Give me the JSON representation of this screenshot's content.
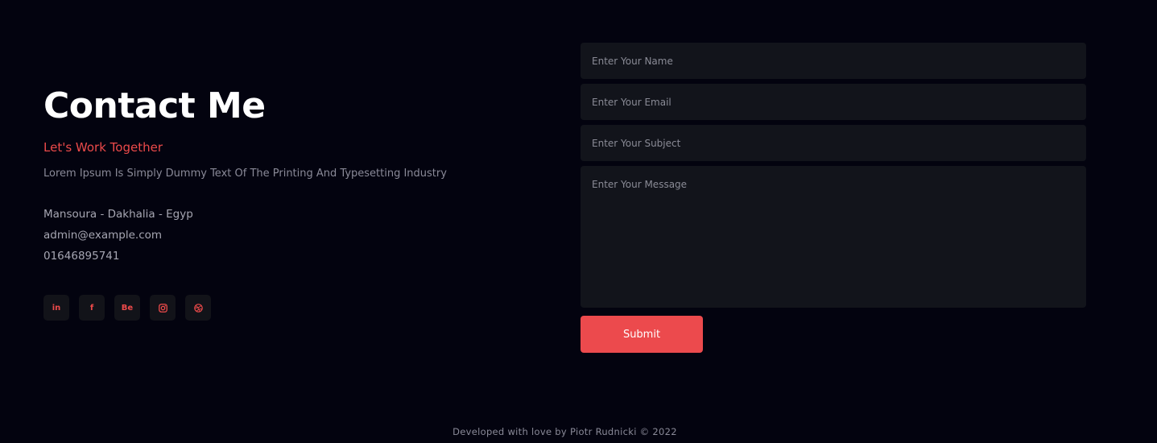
{
  "contact": {
    "title": "Contact Me",
    "subtitle": "Let's Work Together",
    "description": "Lorem Ipsum Is Simply Dummy Text Of The Printing And Typesetting Industry",
    "address": "Mansoura - Dakhalia - Egyp",
    "email": "admin@example.com",
    "phone": "01646895741"
  },
  "socials": [
    {
      "icon": "linkedin-icon",
      "label": "in"
    },
    {
      "icon": "facebook-icon",
      "label": "f"
    },
    {
      "icon": "behance-icon",
      "label": "Be"
    },
    {
      "icon": "instagram-icon",
      "label": ""
    },
    {
      "icon": "dribbble-icon",
      "label": ""
    }
  ],
  "form": {
    "name_placeholder": "Enter Your Name",
    "email_placeholder": "Enter Your Email",
    "subject_placeholder": "Enter Your Subject",
    "message_placeholder": "Enter Your Message",
    "name_value": "",
    "email_value": "",
    "subject_value": "",
    "message_value": "",
    "submit_label": "Submit"
  },
  "footer": {
    "text": "Developed with love by Piotr Rudnicki © 2022"
  },
  "colors": {
    "background": "#03030f",
    "accent": "#ec4a4d",
    "field": "#12141b"
  }
}
